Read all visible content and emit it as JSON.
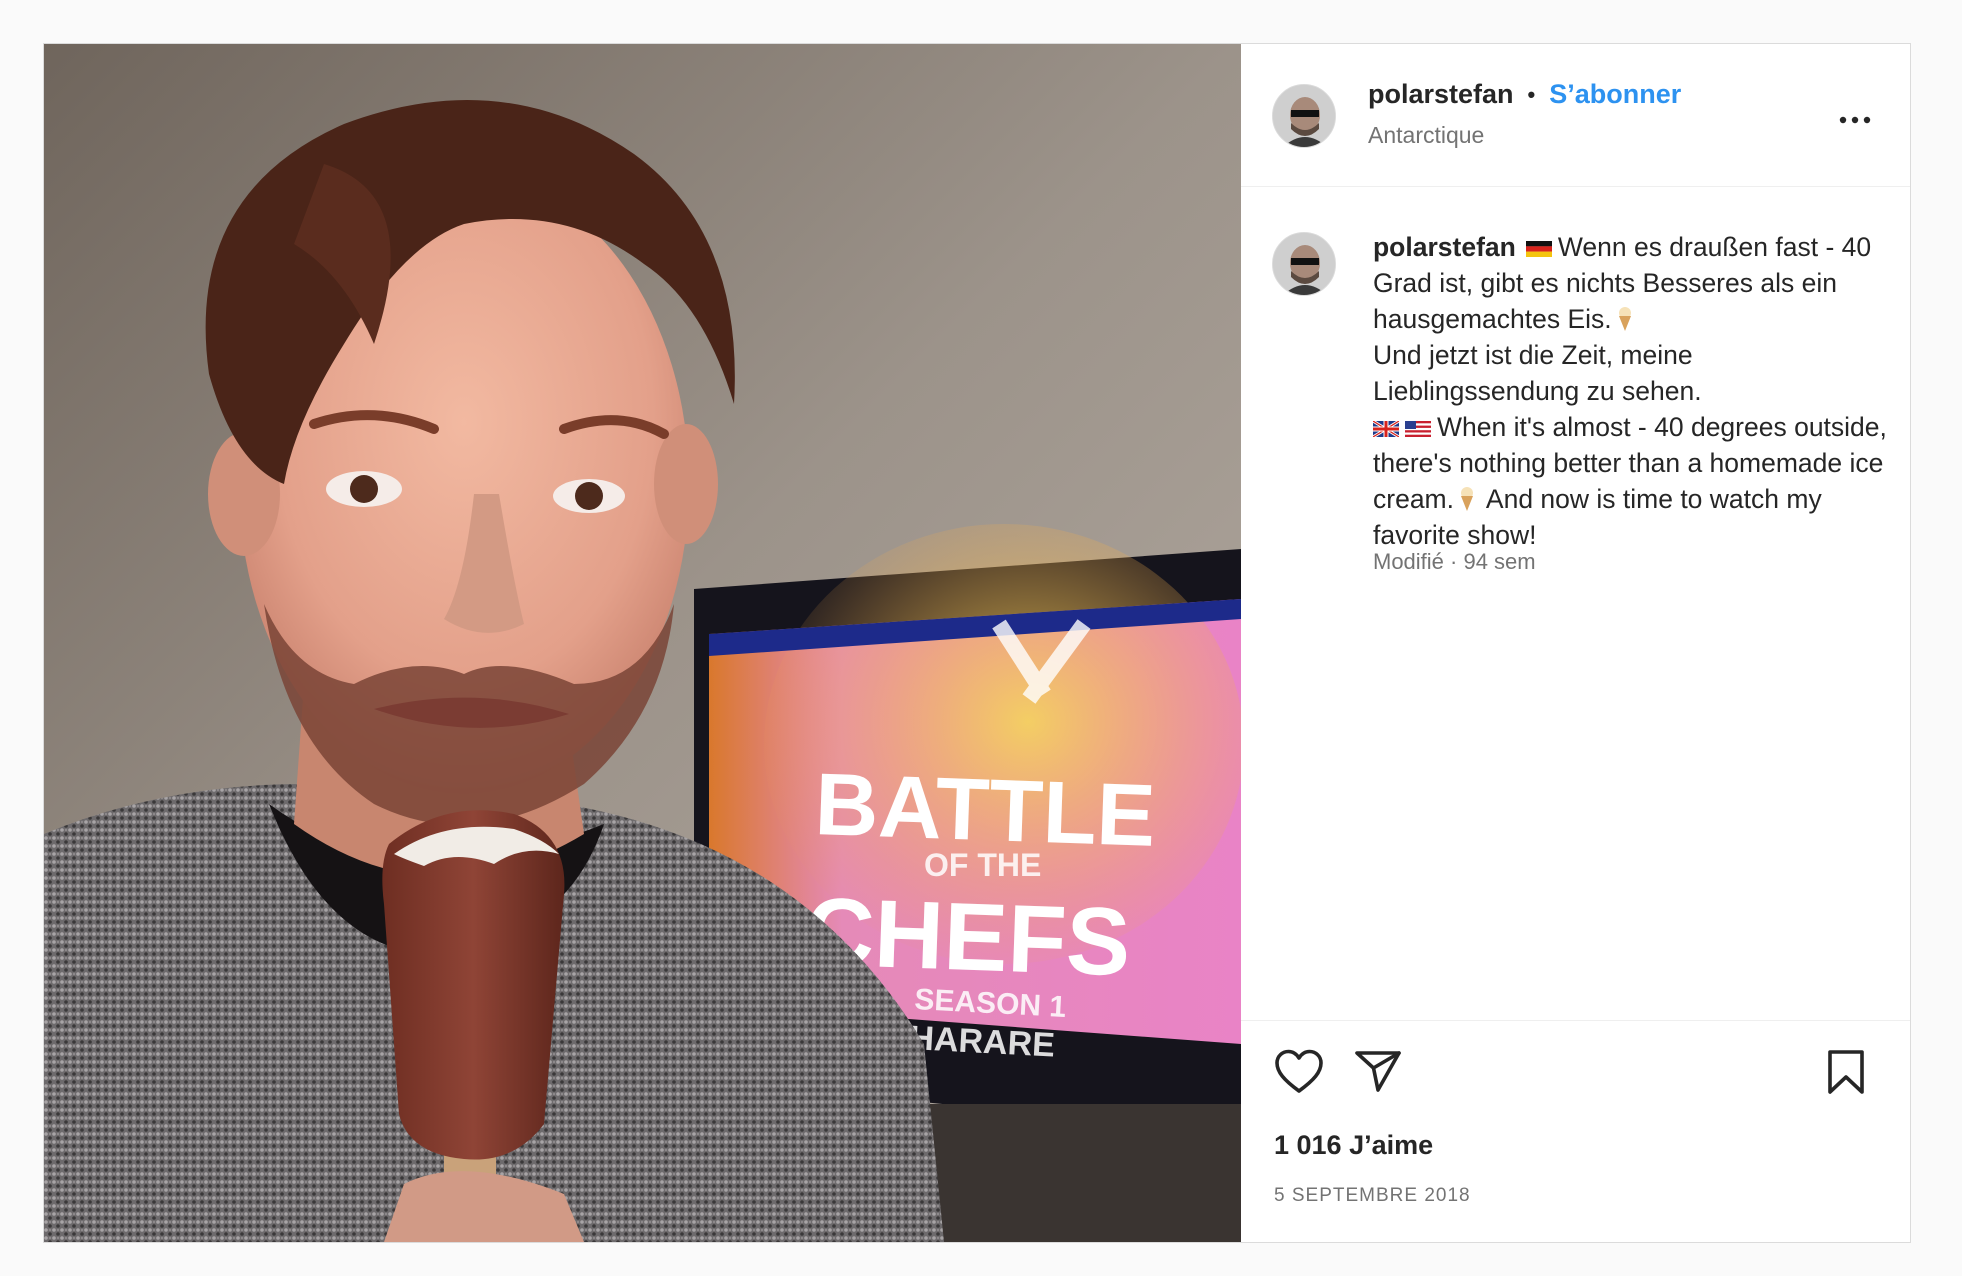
{
  "post": {
    "username": "polarstefan",
    "follow_label": "S’abonner",
    "location": "Antarctique",
    "caption": {
      "line_de_1": "Wenn es draußen fast - 40 Grad ist, gibt es nichts Besseres als ein hausgemachtes Eis.",
      "line_de_2": "Und jetzt ist die Zeit, meine Lieblingssendung zu sehen.",
      "line_en_1": "When it's almost - 40 degrees outside, there's nothing better than a homemade ice cream.",
      "line_en_2": "And now is time to watch my favorite show!"
    },
    "caption_meta": "Modifié · 94 sem",
    "likes": "1 016 J’aime",
    "date": "5 SEPTEMBRE 2018"
  },
  "media": {
    "tv_title_1": "BATTLE",
    "tv_title_of": "OF THE",
    "tv_title_2": "CHEFS",
    "tv_season": "SEASON 1",
    "tv_city": "HARARE"
  },
  "icons": {
    "more": "more-options-icon",
    "like": "heart-icon",
    "share": "paper-plane-icon",
    "save": "bookmark-icon"
  },
  "colors": {
    "accent": "#2d92f0",
    "text": "#262626",
    "muted": "#737373",
    "border": "#dbdbdb"
  }
}
